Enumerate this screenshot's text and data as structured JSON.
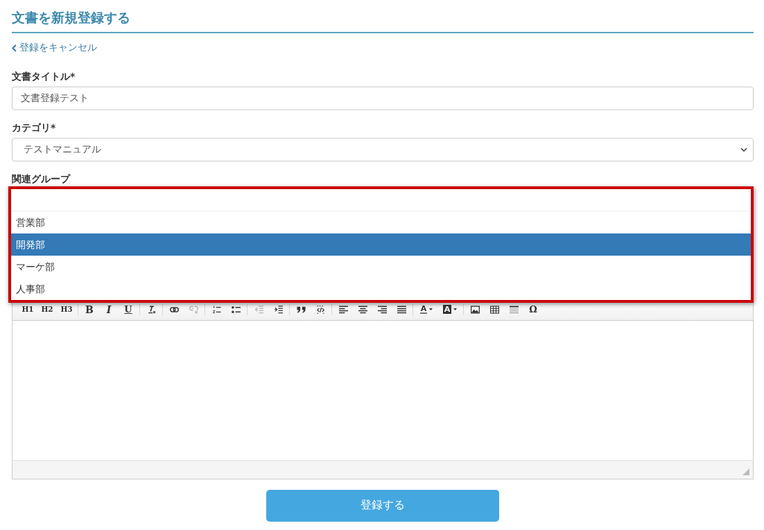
{
  "page_title": "文書を新規登録する",
  "cancel_link": {
    "label": "登録をキャンセル"
  },
  "title_field": {
    "label": "文書タイトル*",
    "value": "文書登録テスト"
  },
  "category_field": {
    "label": "カテゴリ*",
    "value": "テストマニュアル"
  },
  "group_field": {
    "label": "関連グループ",
    "annotation_frame": true,
    "dropdown": {
      "open": true,
      "options": [
        {
          "label": "営業部",
          "selected": false
        },
        {
          "label": "開発部",
          "selected": true
        },
        {
          "label": "マーケ部",
          "selected": false
        },
        {
          "label": "人事部",
          "selected": false
        }
      ]
    }
  },
  "editor": {
    "toolbar": [
      [
        {
          "kind": "heading",
          "label": "H1",
          "disabled": false
        },
        {
          "kind": "heading",
          "label": "H2",
          "disabled": false
        },
        {
          "kind": "heading",
          "label": "H3",
          "disabled": false
        }
      ],
      [
        {
          "kind": "bold",
          "label": "B",
          "disabled": false
        },
        {
          "kind": "italic",
          "label": "I",
          "disabled": false
        },
        {
          "kind": "underline",
          "label": "U",
          "disabled": false
        }
      ],
      [
        {
          "kind": "clear",
          "disabled": false
        }
      ],
      [
        {
          "kind": "link",
          "disabled": false
        },
        {
          "kind": "unlink",
          "disabled": true
        }
      ],
      [
        {
          "kind": "olist",
          "disabled": false
        },
        {
          "kind": "ulist",
          "disabled": false
        }
      ],
      [
        {
          "kind": "outdent",
          "disabled": true
        },
        {
          "kind": "indent",
          "disabled": false
        }
      ],
      [
        {
          "kind": "quote",
          "disabled": false
        },
        {
          "kind": "code",
          "disabled": false
        }
      ],
      [
        {
          "kind": "left",
          "disabled": false
        },
        {
          "kind": "center",
          "disabled": false
        },
        {
          "kind": "right",
          "disabled": false
        },
        {
          "kind": "justify",
          "disabled": false
        }
      ],
      [
        {
          "kind": "color",
          "label": "A",
          "disabled": false
        },
        {
          "kind": "highlight",
          "label": "A",
          "disabled": false
        }
      ],
      [
        {
          "kind": "image",
          "disabled": false
        },
        {
          "kind": "table",
          "disabled": false
        },
        {
          "kind": "rule",
          "disabled": false
        },
        {
          "kind": "symbol",
          "label": "Ω",
          "disabled": false
        }
      ]
    ]
  },
  "submit_button": {
    "label": "登録する"
  }
}
